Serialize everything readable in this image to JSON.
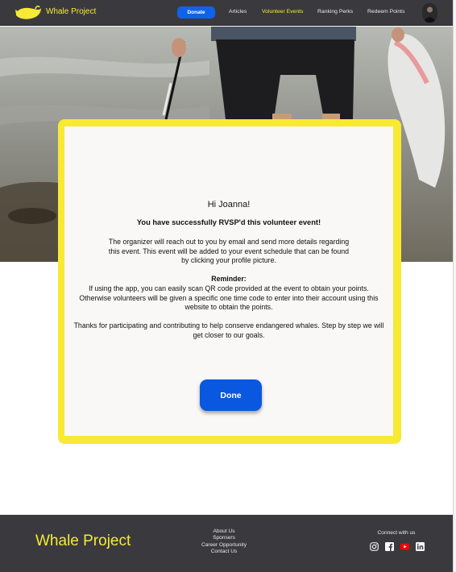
{
  "header": {
    "brand": "Whale Project",
    "donate_label": "Donate",
    "nav": {
      "articles": "Articles",
      "volunteer_events": "Volunteer Events",
      "ranking_perks": "Ranking Perks",
      "redeem_points": "Redeem Points"
    },
    "active_nav": "volunteer_events"
  },
  "modal": {
    "greeting": "Hi Joanna!",
    "heading": "You have successfully RVSP'd this volunteer event!",
    "paragraph1": "The organizer will reach out to you by email and send more details regarding this event. This event will be added to your event schedule that can be found by clicking your profile picture.",
    "reminder_label": "Reminder:",
    "reminder_text": "If using the app, you can easily scan QR code provided at the event to obtain your points. Otherwise volunteers will be given a specific one time code to enter into their account using this website to obtain the points.",
    "closing_text": "Thanks for participating and contributing to help conserve endangered whales. Step by step we will get closer to our goals.",
    "done_label": "Done"
  },
  "footer": {
    "brand": "Whale Project",
    "links": [
      "About Us",
      "Sponsers",
      "Career Opportunity",
      "Contact Us"
    ],
    "connect_label": "Connect with us",
    "social_icons": [
      "instagram-icon",
      "facebook-icon",
      "youtube-icon",
      "linkedin-icon"
    ]
  },
  "colors": {
    "header_bg": "#3a3a3e",
    "brand_yellow": "#f6ea35",
    "primary_blue": "#0f63ea",
    "modal_frame": "#f8e934",
    "modal_bg": "#faf8f6",
    "youtube_red": "#ff0000"
  }
}
